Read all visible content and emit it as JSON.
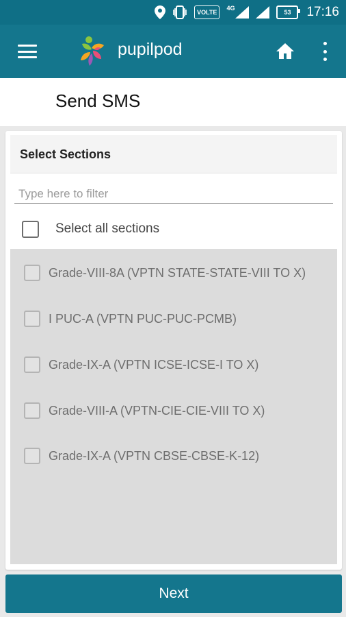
{
  "status_bar": {
    "time": "17:16",
    "battery": "53",
    "volte": "VOLTE",
    "network": "4G",
    "icons": [
      "location-icon",
      "vibrate-icon",
      "volte-icon",
      "signal-icon",
      "signal-icon",
      "battery-icon"
    ]
  },
  "app_bar": {
    "title": "pupilpod",
    "icons": [
      "menu-icon",
      "pupilpod-logo",
      "home-icon",
      "more-vert-icon"
    ],
    "colors": {
      "primary": "#14768d",
      "status": "#0f6f86"
    }
  },
  "page": {
    "title": "Send SMS"
  },
  "card": {
    "header": "Select Sections",
    "filter_placeholder": "Type here to filter",
    "filter_value": "",
    "select_all_label": "Select all sections",
    "sections": [
      {
        "label": "Grade-VIII-8A (VPTN STATE-STATE-VIII TO X)",
        "checked": false
      },
      {
        "label": "I PUC-A (VPTN PUC-PUC-PCMB)",
        "checked": false
      },
      {
        "label": "Grade-IX-A (VPTN ICSE-ICSE-I TO X)",
        "checked": false
      },
      {
        "label": "Grade-VIII-A (VPTN-CIE-CIE-VIII TO X)",
        "checked": false
      },
      {
        "label": "Grade-IX-A (VPTN CBSE-CBSE-K-12)",
        "checked": false
      }
    ]
  },
  "footer": {
    "next_label": "Next"
  }
}
